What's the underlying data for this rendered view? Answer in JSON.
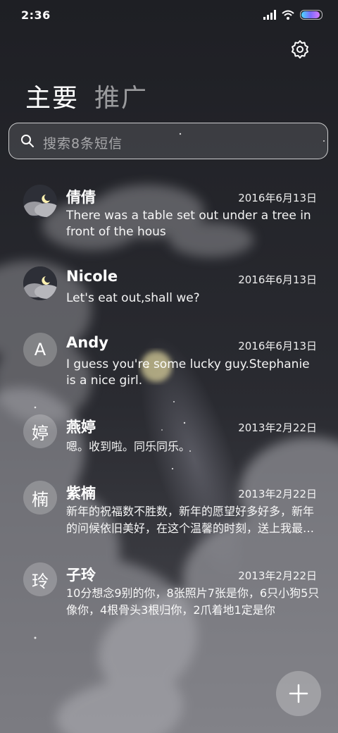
{
  "statusbar": {
    "time": "2:36",
    "signal_icon": "signal-icon",
    "wifi_icon": "wifi-icon",
    "battery_icon": "battery-icon",
    "battery_level": 0.95
  },
  "header": {
    "settings_icon": "gear-icon"
  },
  "tabs": [
    {
      "label": "主要",
      "active": true
    },
    {
      "label": "推广",
      "active": false
    }
  ],
  "search": {
    "placeholder": "搜索8条短信",
    "icon": "search-icon"
  },
  "conversations": [
    {
      "name": "倩倩",
      "date": "2016年6月13日",
      "preview": "There was a table set out under a tree in front of the hous",
      "avatar": "photo"
    },
    {
      "name": "Nicole",
      "date": "2016年6月13日",
      "preview": "Let's eat out,shall we?",
      "avatar": "photo"
    },
    {
      "name": "Andy",
      "date": "2016年6月13日",
      "preview": "I guess you're some lucky guy.Stephanie is a nice girl.",
      "avatar": "A"
    },
    {
      "name": "燕婷",
      "date": "2013年2月22日",
      "preview": "嗯。收到啦。同乐同乐。",
      "avatar": "婷"
    },
    {
      "name": "紫楠",
      "date": "2013年2月22日",
      "preview": "新年的祝福数不胜数，新年的愿望好多好多，新年的问候依旧美好，在这个温馨的时刻，送上我最真挚的祝福",
      "avatar": "楠"
    },
    {
      "name": "子玲",
      "date": "2013年2月22日",
      "preview": "10分想念9别的你，8张照片7张是你，6只小狗5只像你，4根骨头3根归你，2爪着地1定是你",
      "avatar": "玲"
    }
  ],
  "fab": {
    "icon": "plus-icon"
  },
  "colors": {
    "background": "#222227",
    "text": "#ffffff",
    "muted": "#8c8c90"
  }
}
